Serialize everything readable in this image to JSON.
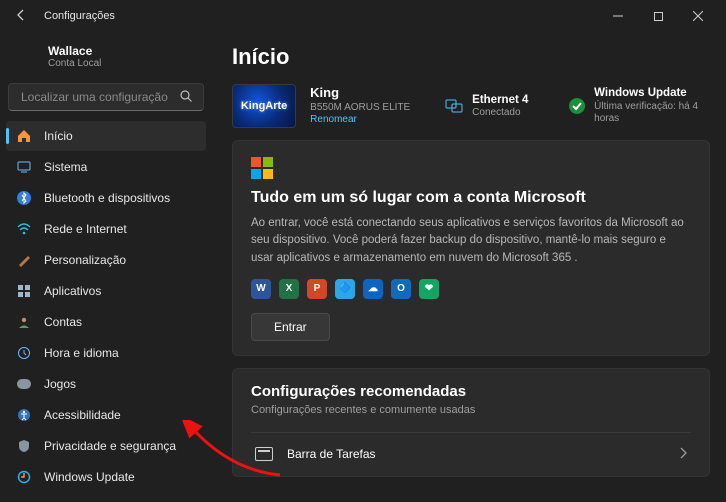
{
  "window": {
    "title": "Configurações"
  },
  "user": {
    "name": "Wallace",
    "account_type": "Conta Local"
  },
  "search": {
    "placeholder": "Localizar uma configuração"
  },
  "nav": {
    "items": [
      {
        "label": "Início",
        "icon": "home",
        "active": true
      },
      {
        "label": "Sistema",
        "icon": "system"
      },
      {
        "label": "Bluetooth e dispositivos",
        "icon": "bluetooth"
      },
      {
        "label": "Rede e Internet",
        "icon": "wifi"
      },
      {
        "label": "Personalização",
        "icon": "brush"
      },
      {
        "label": "Aplicativos",
        "icon": "apps"
      },
      {
        "label": "Contas",
        "icon": "accounts"
      },
      {
        "label": "Hora e idioma",
        "icon": "time"
      },
      {
        "label": "Jogos",
        "icon": "games"
      },
      {
        "label": "Acessibilidade",
        "icon": "accessibility"
      },
      {
        "label": "Privacidade e segurança",
        "icon": "privacy"
      },
      {
        "label": "Windows Update",
        "icon": "update"
      }
    ]
  },
  "page": {
    "heading": "Início"
  },
  "device": {
    "thumb_text": "KingArte",
    "name": "King",
    "model": "B550M AORUS ELITE",
    "rename": "Renomear"
  },
  "net": {
    "title": "Ethernet 4",
    "status": "Conectado"
  },
  "update": {
    "title": "Windows Update",
    "status": "Última verificação: há 4 horas"
  },
  "ms_card": {
    "heading": "Tudo em um só lugar com a conta Microsoft",
    "desc": "Ao entrar, você está conectando seus aplicativos e serviços favoritos da Microsoft ao seu dispositivo. Você poderá fazer backup do dispositivo, mantê-lo mais seguro e usar aplicativos e armazenamento em nuvem do Microsoft 365 .",
    "signin": "Entrar",
    "apps": [
      {
        "letter": "W",
        "color": "#2b579a"
      },
      {
        "letter": "X",
        "color": "#217346"
      },
      {
        "letter": "P",
        "color": "#d24726"
      },
      {
        "letter": "🔷",
        "color": "#28a8ea"
      },
      {
        "letter": "☁",
        "color": "#0a66c2"
      },
      {
        "letter": "O",
        "color": "#0f6cbd"
      },
      {
        "letter": "❤",
        "color": "#13a563"
      }
    ]
  },
  "rec": {
    "heading": "Configurações recomendadas",
    "sub": "Configurações recentes e comumente usadas",
    "items": [
      {
        "label": "Barra de Tarefas"
      }
    ]
  }
}
